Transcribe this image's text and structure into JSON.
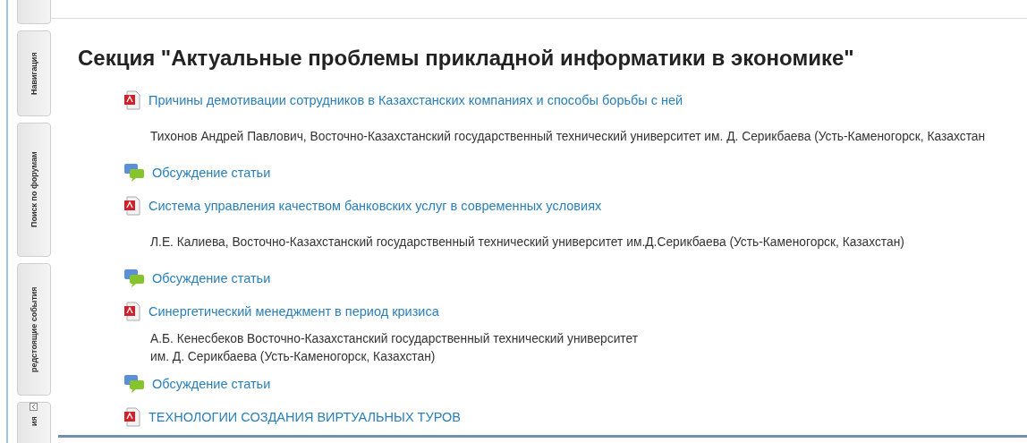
{
  "sidebar": {
    "tabs": [
      {
        "kind": "stub"
      },
      {
        "label": "Навигация",
        "kind": "tab"
      },
      {
        "label": "Поиск по форумам",
        "kind": "tab"
      },
      {
        "label": "редстоящие события",
        "kind": "tab"
      },
      {
        "label": "ия",
        "kind": "collapsed"
      }
    ]
  },
  "section": {
    "title": "Секция \"Актуальные проблемы прикладной информатики в экономике\"",
    "items": [
      {
        "kind": "file",
        "text": "Причины демотивации сотрудников в Казахстанских компаниях и способы борьбы с ней"
      },
      {
        "kind": "authors",
        "text": "Тихонов Андрей Павлович, Восточно-Казахстанский государственный технический университет им. Д. Серикбаева (Усть-Каменогорск, Казахстан"
      },
      {
        "kind": "discussion",
        "text": "Обсуждение статьи"
      },
      {
        "kind": "file",
        "text": "Система управления качеством банковских услуг в современных условиях"
      },
      {
        "kind": "authors",
        "text": "Л.Е. Калиева, Восточно-Казахстанский государственный технический университет им.Д.Серикбаева (Усть-Каменогорск, Казахстан)"
      },
      {
        "kind": "discussion",
        "text": "Обсуждение статьи"
      },
      {
        "kind": "file",
        "text": "Синергетический менеджмент в период кризиса"
      },
      {
        "kind": "authors",
        "lines": [
          "А.Б. Кенесбеков Восточно-Казахстанский государственный технический университет",
          "им. Д. Серикбаева (Усть-Каменогорск, Казахстан)"
        ]
      },
      {
        "kind": "discussion",
        "text": "Обсуждение статьи"
      },
      {
        "kind": "file",
        "text": "ТЕХНОЛОГИИ СОЗДАНИЯ ВИРТУАЛЬНЫХ ТУРОВ"
      }
    ]
  }
}
